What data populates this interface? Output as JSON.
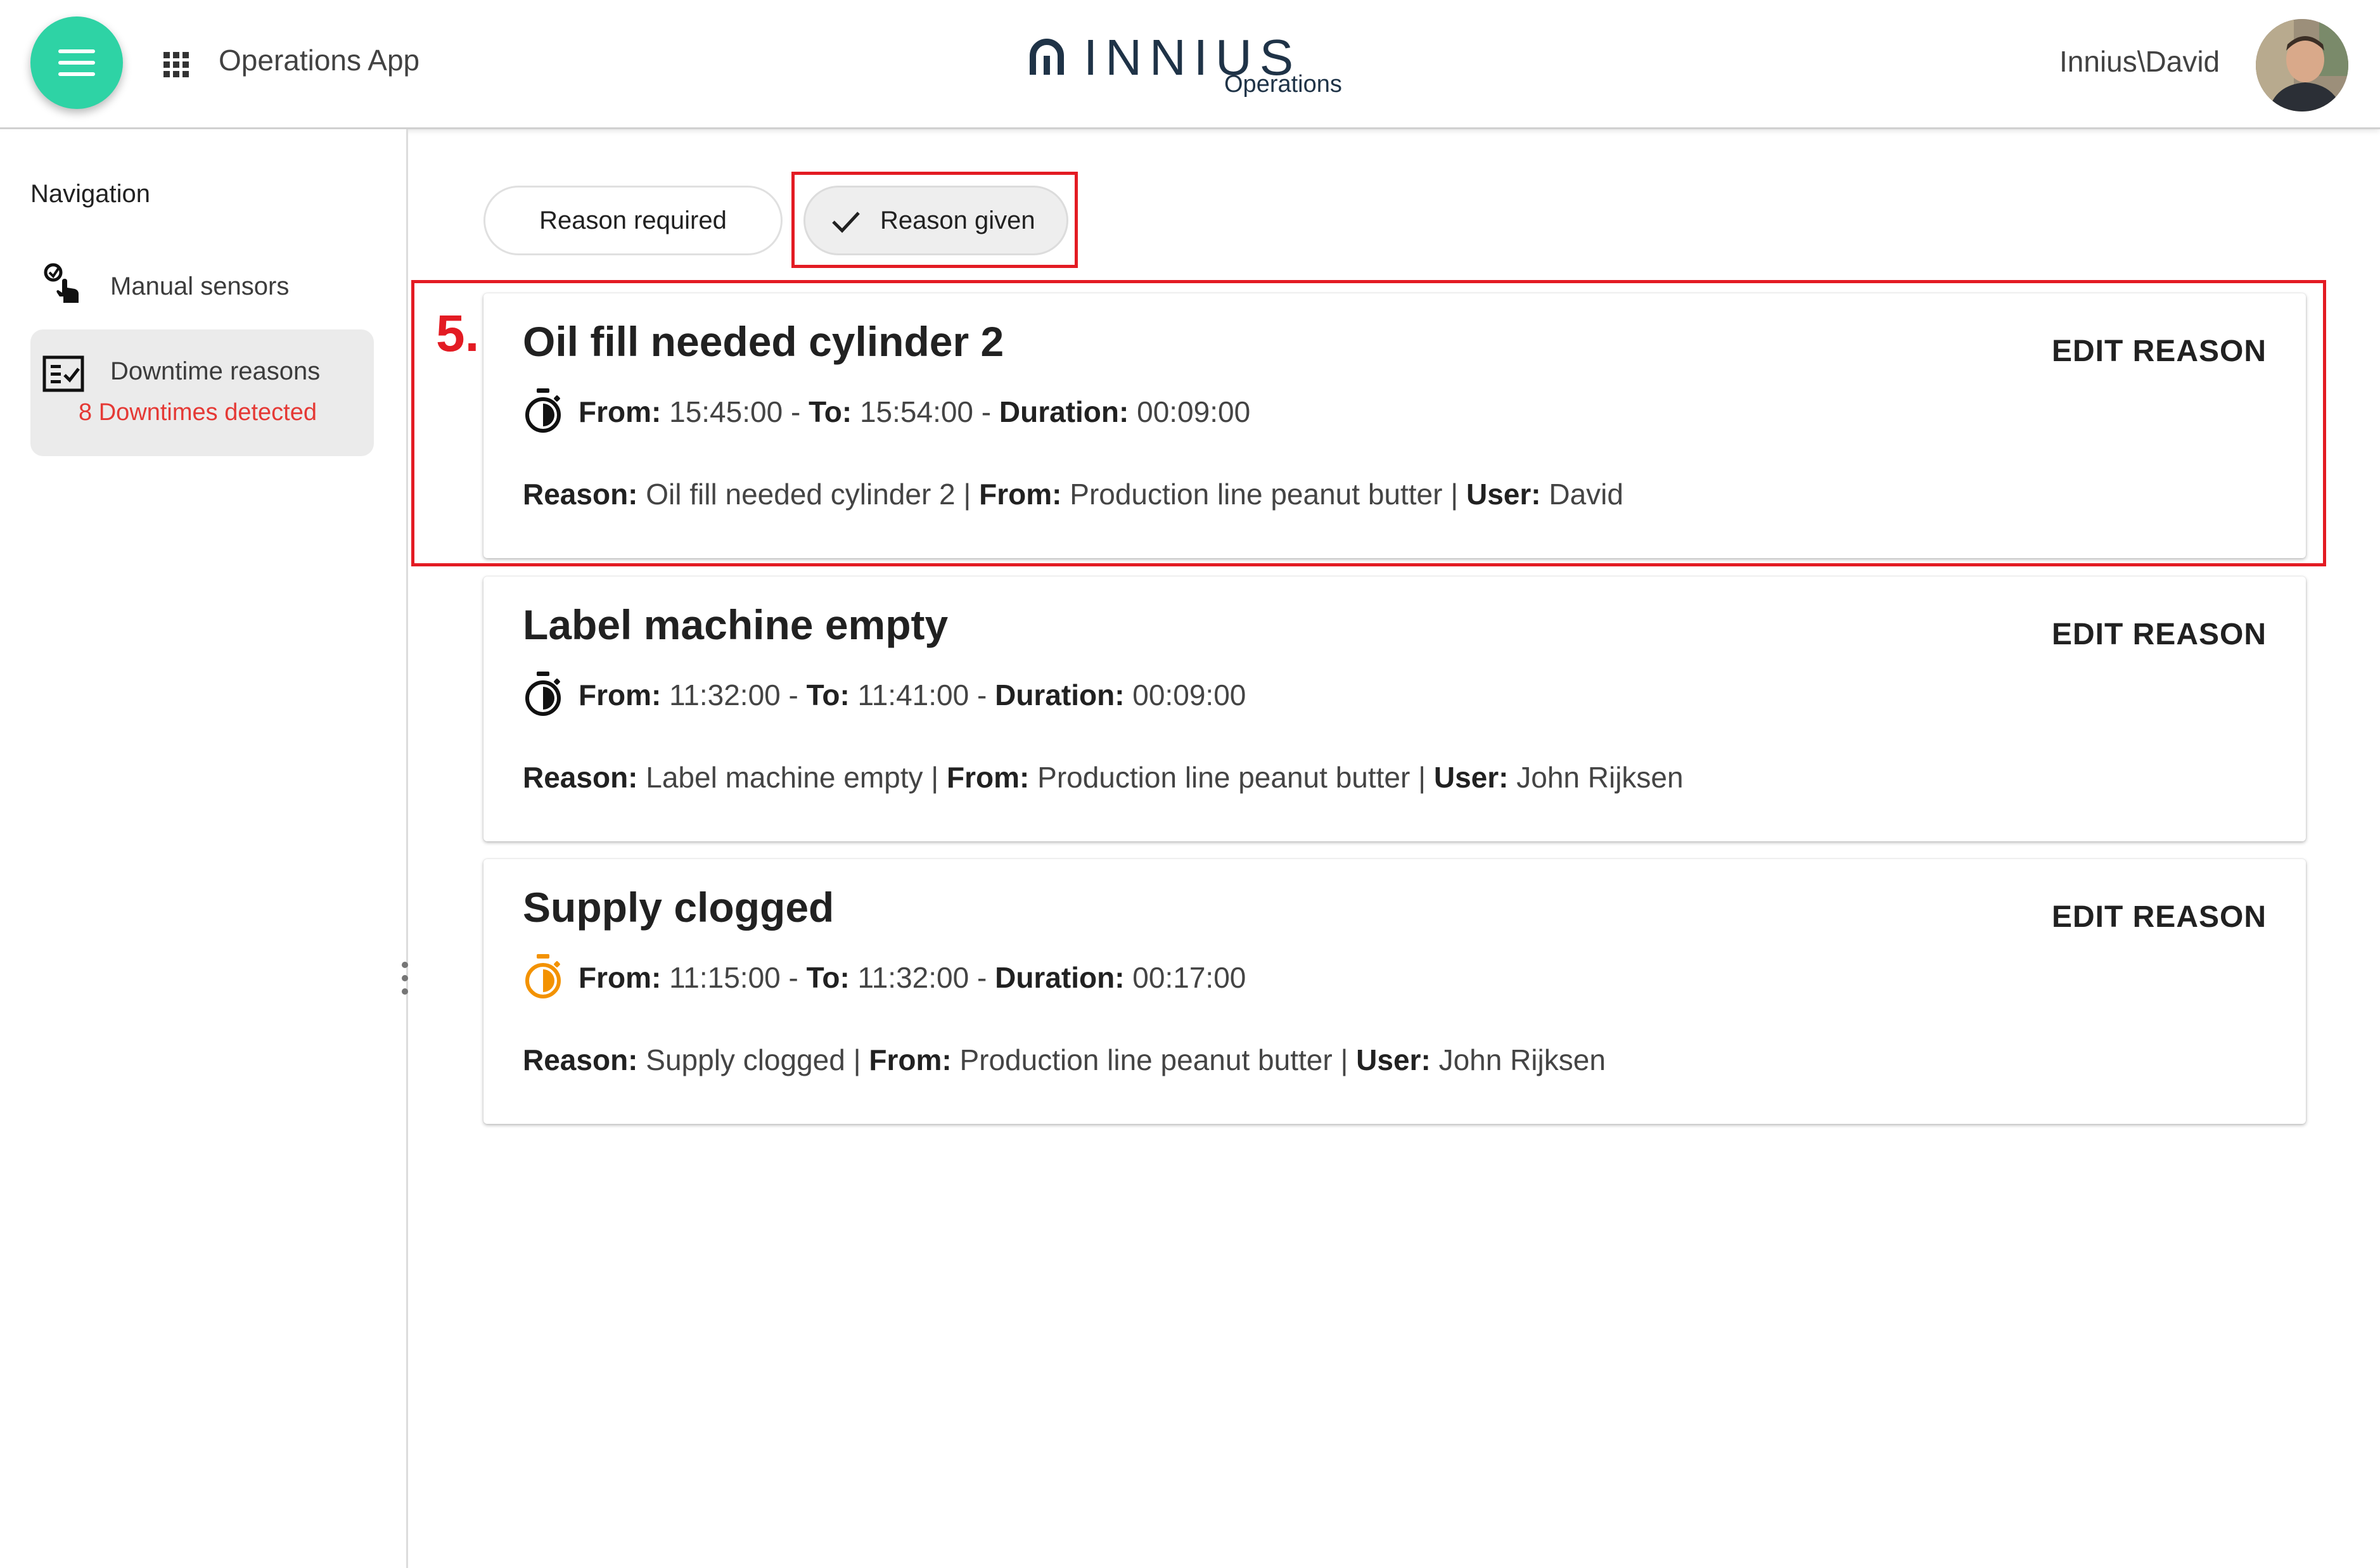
{
  "header": {
    "app_title": "Operations App",
    "brand_name": "INNIUS",
    "brand_sub": "Operations",
    "user": "Innius\\David",
    "menu_icon": "menu-icon",
    "apps_icon": "apps-grid-icon",
    "accent_color": "#2ed3a5"
  },
  "sidebar": {
    "heading": "Navigation",
    "items": [
      {
        "label": "Manual sensors",
        "icon": "touch-sensor-icon"
      },
      {
        "label": "Downtime reasons",
        "icon": "checklist-icon",
        "badge": "8 Downtimes detected",
        "active": true
      }
    ]
  },
  "filters": {
    "chips": [
      {
        "label": "Reason required",
        "selected": false
      },
      {
        "label": "Reason given",
        "selected": true
      }
    ]
  },
  "annotation": {
    "step": "5.",
    "color": "#e31b23"
  },
  "labels": {
    "from": "From:",
    "to": "To:",
    "duration": "Duration:",
    "reason": "Reason:",
    "user": "User:",
    "edit": "EDIT REASON",
    "dash": "-",
    "pipe": "|"
  },
  "downtimes": [
    {
      "title": "Oil fill needed cylinder 2",
      "from": "15:45:00",
      "to": "15:54:00",
      "duration": "00:09:00",
      "reason": "Oil fill needed cylinder 2",
      "source": "Production line peanut butter",
      "user": "David",
      "timer_color": "#111111"
    },
    {
      "title": "Label machine empty",
      "from": "11:32:00",
      "to": "11:41:00",
      "duration": "00:09:00",
      "reason": "Label machine empty",
      "source": "Production line peanut butter",
      "user": "John Rijksen",
      "timer_color": "#111111"
    },
    {
      "title": "Supply clogged",
      "from": "11:15:00",
      "to": "11:32:00",
      "duration": "00:17:00",
      "reason": "Supply clogged",
      "source": "Production line peanut butter",
      "user": "John Rijksen",
      "timer_color": "#f39200"
    }
  ]
}
